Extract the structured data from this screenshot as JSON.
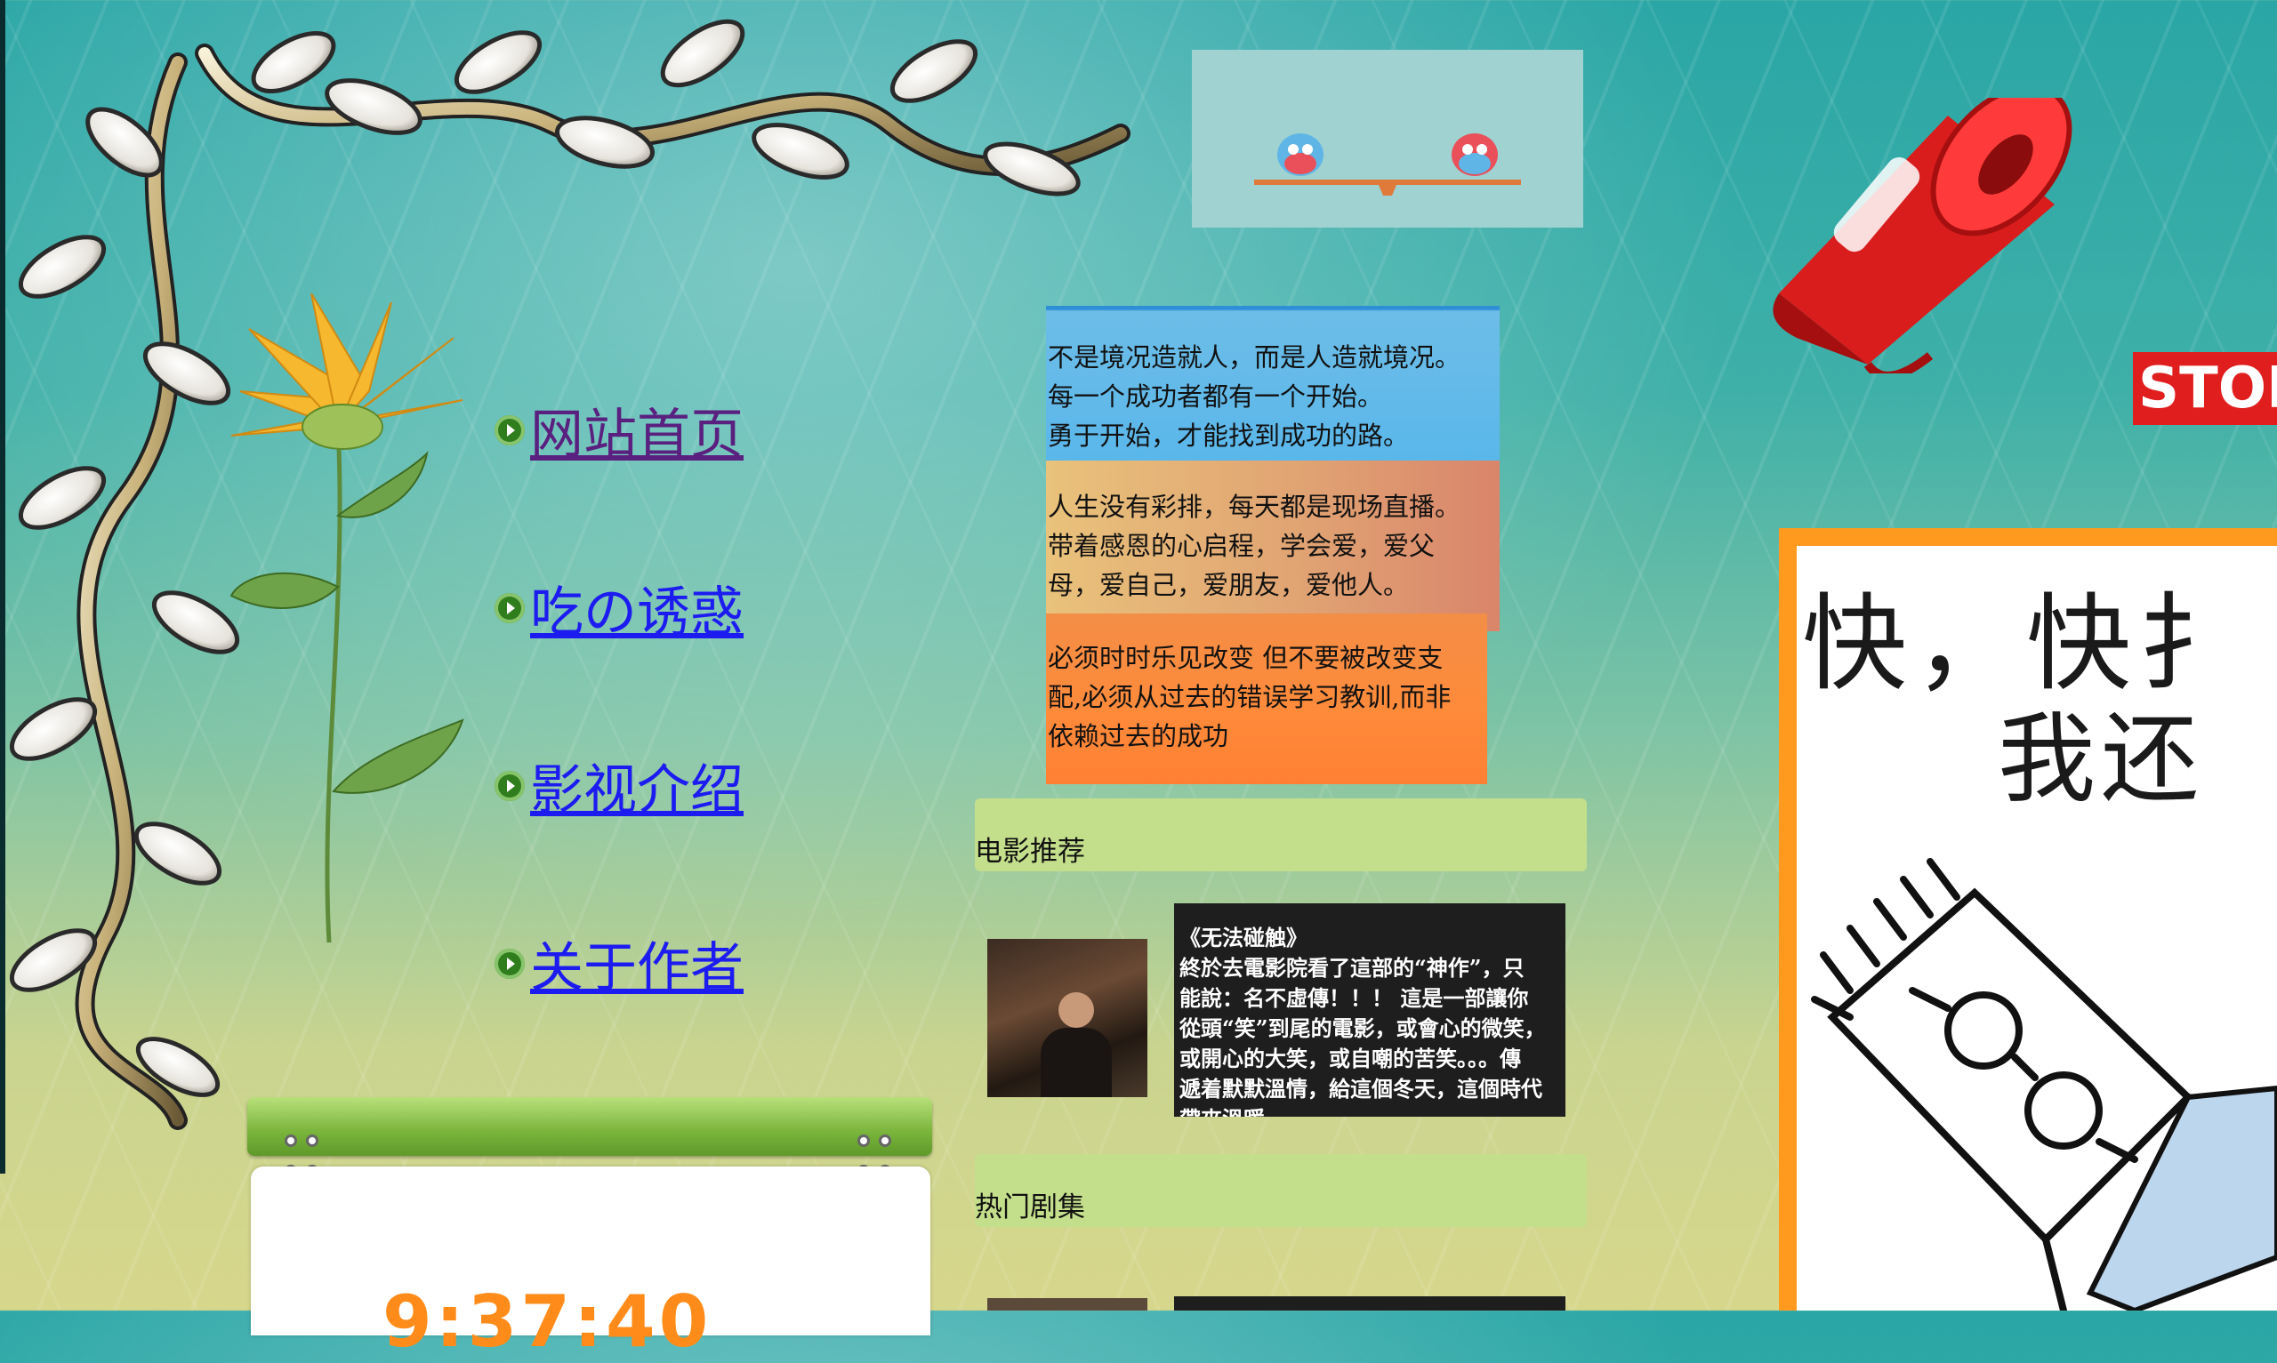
{
  "nav": {
    "items": [
      {
        "label": "网站首页"
      },
      {
        "label": "吃の诱惑"
      },
      {
        "label": "影视介绍"
      },
      {
        "label": "关于作者"
      }
    ]
  },
  "quotes": [
    {
      "lines": [
        "不是境况造就人，而是人造就境况。",
        "每一个成功者都有一个开始。",
        "勇于开始，才能找到成功的路。"
      ]
    },
    {
      "lines": [
        "人生没有彩排，每天都是现场直播。",
        "带着感恩的心启程，学会爱，爱父",
        "母，爱自己，爱朋友，爱他人。"
      ]
    },
    {
      "lines": [
        "必须时时乐见改变 但不要被改变支",
        "配,必须从过去的错误学习教训,而非",
        "依赖过去的成功"
      ]
    }
  ],
  "sections": {
    "movies": {
      "title": "电影推荐"
    },
    "series": {
      "title": "热门剧集"
    }
  },
  "movie": {
    "title": "《无法碰触》",
    "lines": [
      "終於去電影院看了這部的“神作”，只",
      "能說：名不虛傳！！！ 這是一部讓你",
      "從頭“笑”到尾的電影，或會心的微笑，",
      "或開心的大笑，或自嘲的苦笑。。。傳",
      "遞着默默溫情，給這個冬天，這個時代",
      "帶來溫暖。"
    ]
  },
  "clock": {
    "time": "9:37:40"
  },
  "stop_sign": {
    "text": "STOP"
  },
  "comic": {
    "line1": "快，快扌",
    "line2": "我还"
  },
  "colors": {
    "link": "#1c1cf0",
    "visited": "#5a2080",
    "clock": "#ff8c1a",
    "section_bg": "#c4df8b"
  }
}
